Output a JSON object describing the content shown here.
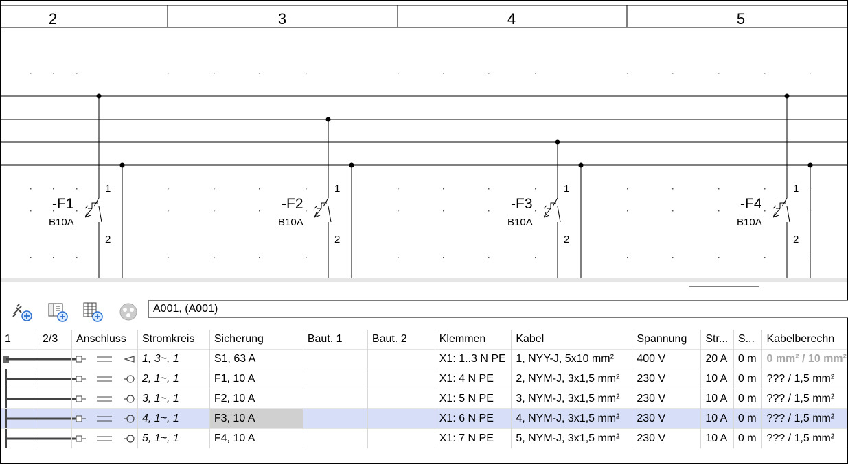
{
  "schematic": {
    "column_numbers": [
      "2",
      "3",
      "4",
      "5"
    ],
    "devices": [
      {
        "tag": "-F1",
        "rating": "B10A",
        "pin_top": "1",
        "pin_bottom": "2"
      },
      {
        "tag": "-F2",
        "rating": "B10A",
        "pin_top": "1",
        "pin_bottom": "2"
      },
      {
        "tag": "-F3",
        "rating": "B10A",
        "pin_top": "1",
        "pin_bottom": "2"
      },
      {
        "tag": "-F4",
        "rating": "B10A",
        "pin_top": "1",
        "pin_bottom": "2"
      }
    ]
  },
  "toolbar": {
    "icons": [
      "plug-add-icon",
      "device-add-icon",
      "panel-add-icon",
      "three-phase-icon"
    ],
    "address_value": "A001,  (A001)"
  },
  "table": {
    "headers": [
      "1",
      "2/3",
      "Anschluss",
      "Stromkreis",
      "Sicherung",
      "Baut. 1",
      "Baut. 2",
      "Klemmen",
      "Kabel",
      "Spannung",
      "Str...",
      "S...",
      "Kabelberechn"
    ],
    "rows": [
      {
        "stromkreis": "1, 3~, 1",
        "sicherung": "S1, 63 A",
        "klemmen": "X1: 1..3 N PE",
        "kabel": "1, NYY-J, 5x10 mm²",
        "spannung": "400 V",
        "strom": "20 A",
        "s": "0 m",
        "kabelberechnung": "0 mm² / 10 mm²",
        "selected": false
      },
      {
        "stromkreis": "2, 1~, 1",
        "sicherung": "F1, 10 A",
        "klemmen": "X1: 4 N PE",
        "kabel": "2, NYM-J, 3x1,5 mm²",
        "spannung": "230 V",
        "strom": "10 A",
        "s": "0 m",
        "kabelberechnung": "??? / 1,5 mm²",
        "selected": false
      },
      {
        "stromkreis": "3, 1~, 1",
        "sicherung": "F2, 10 A",
        "klemmen": "X1: 5 N PE",
        "kabel": "3, NYM-J, 3x1,5 mm²",
        "spannung": "230 V",
        "strom": "10 A",
        "s": "0 m",
        "kabelberechnung": "??? / 1,5 mm²",
        "selected": false
      },
      {
        "stromkreis": "4, 1~, 1",
        "sicherung": "F3, 10 A",
        "klemmen": "X1: 6 N PE",
        "kabel": "4, NYM-J, 3x1,5 mm²",
        "spannung": "230 V",
        "strom": "10 A",
        "s": "0 m",
        "kabelberechnung": "??? / 1,5 mm²",
        "selected": true
      },
      {
        "stromkreis": "5, 1~, 1",
        "sicherung": "F4, 10 A",
        "klemmen": "X1: 7 N PE",
        "kabel": "5, NYM-J, 3x1,5 mm²",
        "spannung": "230 V",
        "strom": "10 A",
        "s": "0 m",
        "kabelberechnung": "??? / 1,5 mm²",
        "selected": false
      }
    ]
  },
  "colors": {
    "selection": "#d6def8",
    "selected_cell": "#d0d0d0",
    "line": "#000000"
  }
}
